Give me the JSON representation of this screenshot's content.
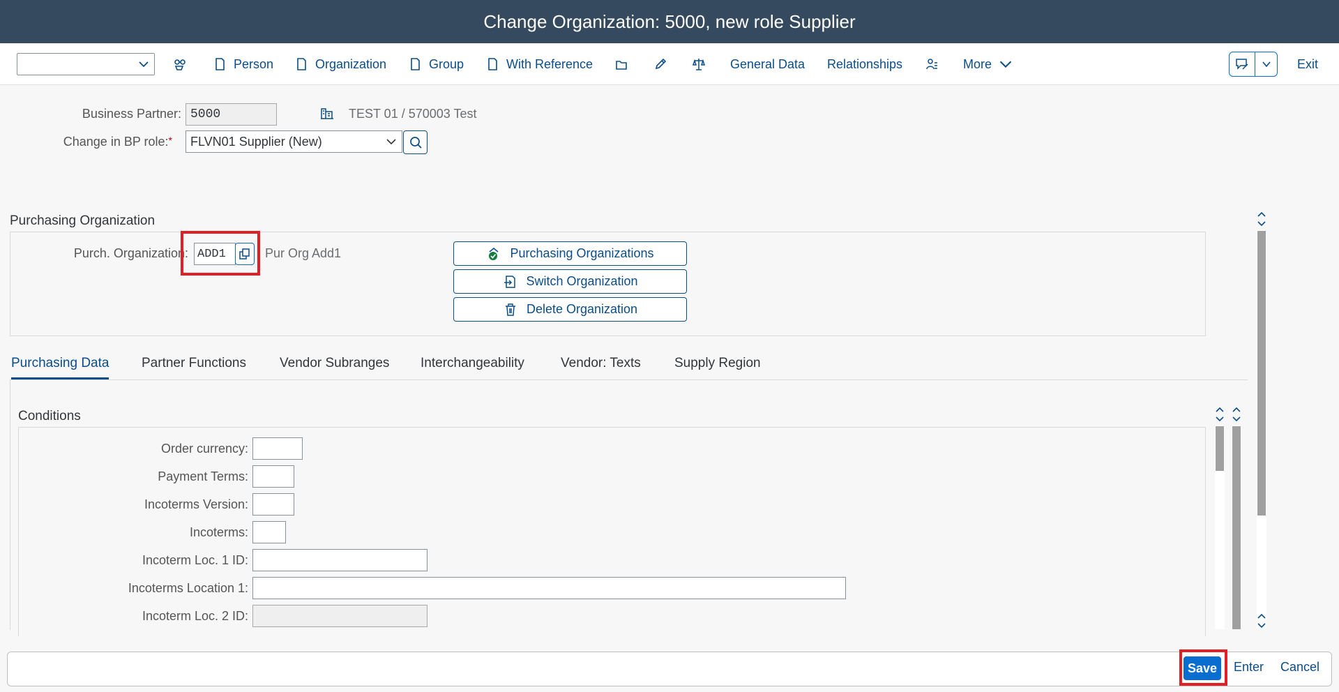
{
  "window": {
    "title": "Change Organization: 5000, new role Supplier"
  },
  "toolbar": {
    "command_value": "",
    "person": "Person",
    "organization": "Organization",
    "group": "Group",
    "with_reference": "With Reference",
    "general_data": "General Data",
    "relationships": "Relationships",
    "more": "More",
    "exit": "Exit"
  },
  "header": {
    "bp_label": "Business Partner:",
    "bp_value": "5000",
    "bp_description": "TEST 01 / 570003 Test",
    "role_label": "Change in BP role:",
    "role_required": "*",
    "role_value": "FLVN01 Supplier (New)"
  },
  "purch_org": {
    "section_title": "Purchasing Organization",
    "label": "Purch. Organization:",
    "value": "ADD1",
    "description": "Pur Org Add1",
    "buttons": [
      "Purchasing Organizations",
      "Switch Organization",
      "Delete Organization"
    ]
  },
  "tabs": [
    "Purchasing Data",
    "Partner Functions",
    "Vendor Subranges",
    "Interchangeability",
    "Vendor: Texts",
    "Supply Region"
  ],
  "conditions": {
    "title": "Conditions",
    "fields": [
      {
        "label": "Order currency:",
        "value": ""
      },
      {
        "label": "Payment Terms:",
        "value": ""
      },
      {
        "label": "Incoterms Version:",
        "value": ""
      },
      {
        "label": "Incoterms:",
        "value": ""
      },
      {
        "label": "Incoterm Loc. 1 ID:",
        "value": ""
      },
      {
        "label": "Incoterms Location 1:",
        "value": ""
      },
      {
        "label": "Incoterm Loc. 2 ID:",
        "value": ""
      }
    ]
  },
  "footer": {
    "save": "Save",
    "enter": "Enter",
    "cancel": "Cancel"
  },
  "colors": {
    "title_bar": "#354a5f",
    "accent": "#0a6ed1",
    "link": "#0a4d8c",
    "highlight": "#e01f26"
  }
}
